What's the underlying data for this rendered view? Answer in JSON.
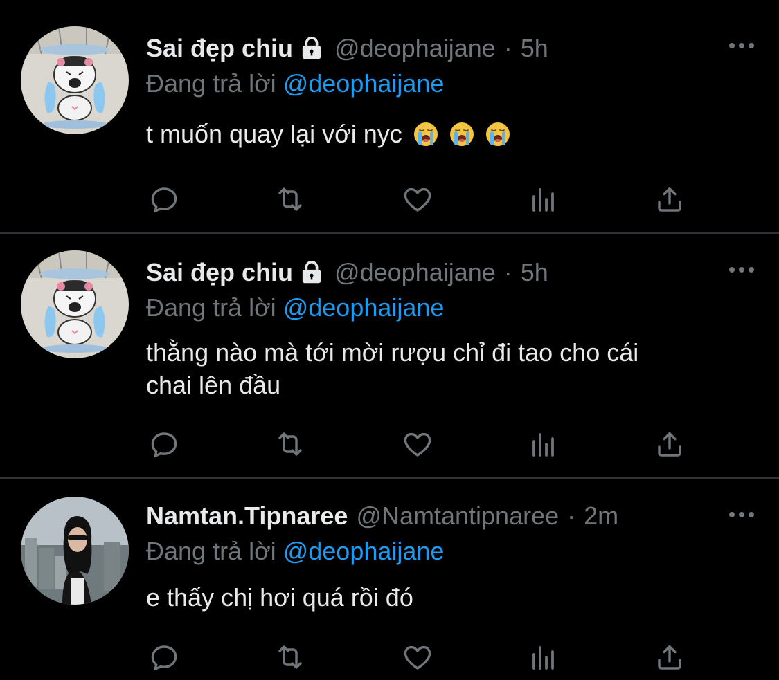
{
  "colors": {
    "background": "#000000",
    "text": "#e7e9ea",
    "muted": "#71767b",
    "link": "#1d9bf0",
    "divider": "#2f3336"
  },
  "tweets": [
    {
      "name": "Sai đẹp chiu",
      "handle": "@deophaijane",
      "dot": "·",
      "time": "5h",
      "reply_prefix": "Đang trả lời",
      "reply_to": "@deophaijane",
      "text": "t muốn quay lại với nyc",
      "emojis": [
        "loudly-crying-face",
        "loudly-crying-face",
        "loudly-crying-face"
      ],
      "protected": true,
      "avatar": "cartoon-crying-avatar"
    },
    {
      "name": "Sai đẹp chiu",
      "handle": "@deophaijane",
      "dot": "·",
      "time": "5h",
      "reply_prefix": "Đang trả lời",
      "reply_to": "@deophaijane",
      "text_line1": "thằng nào mà tới mời rượu chỉ đi tao cho cái",
      "text_line2": "chai lên đầu",
      "protected": true,
      "avatar": "cartoon-crying-avatar"
    },
    {
      "name": "Namtan.Tipnaree",
      "handle": "@Namtantipnaree",
      "dot": "·",
      "time": "2m",
      "reply_prefix": "Đang trả lời",
      "reply_to": "@deophaijane",
      "text": "e thấy chị hơi quá rồi đó",
      "protected": false,
      "avatar": "photo-avatar"
    }
  ],
  "icons": [
    "reply-icon",
    "retweet-icon",
    "like-icon",
    "views-icon",
    "share-icon",
    "more-icon",
    "lock-icon"
  ]
}
